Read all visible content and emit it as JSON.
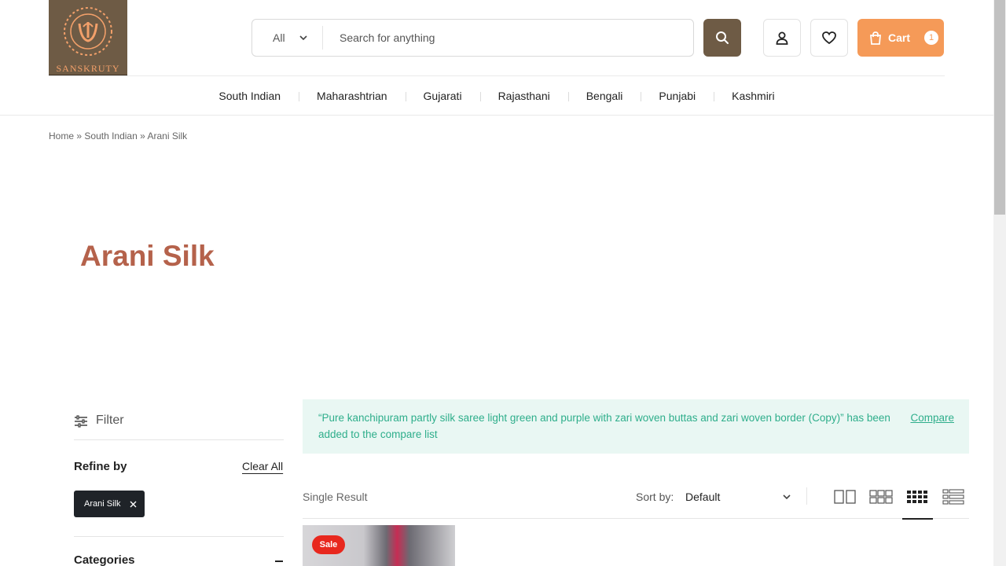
{
  "header": {
    "logo_text": "SANSKRUTY",
    "search": {
      "category": "All",
      "placeholder": "Search for anything"
    },
    "cart": {
      "label": "Cart",
      "count": "1"
    }
  },
  "nav": {
    "items": [
      "South Indian",
      "Maharashtrian",
      "Gujarati",
      "Rajasthani",
      "Bengali",
      "Punjabi",
      "Kashmiri"
    ]
  },
  "breadcrumb": {
    "home": "Home",
    "sep1": "»",
    "category": "South Indian",
    "sep2": "»",
    "current": "Arani Silk"
  },
  "page": {
    "title": "Arani Silk"
  },
  "sidebar": {
    "filter_label": "Filter",
    "refine_label": "Refine by",
    "clear_all": "Clear All",
    "active_filter": "Arani Silk",
    "categories_label": "Categories"
  },
  "notice": {
    "message_line1": "“Pure kanchipuram partly silk saree light green and purple with zari woven buttas and zari woven border (Copy)” has been",
    "message_line2": "added to the compare list",
    "compare_link": "Compare"
  },
  "toolbar": {
    "result_count": "Single Result",
    "sort_label": "Sort by:",
    "sort_value": "Default"
  },
  "product": {
    "badge": "Sale"
  },
  "colors": {
    "brand_brown": "#6e5b45",
    "cart_orange": "#f59a58",
    "title_rust": "#b5624b",
    "notice_green": "#2eae8b",
    "sale_red": "#e8281e"
  }
}
